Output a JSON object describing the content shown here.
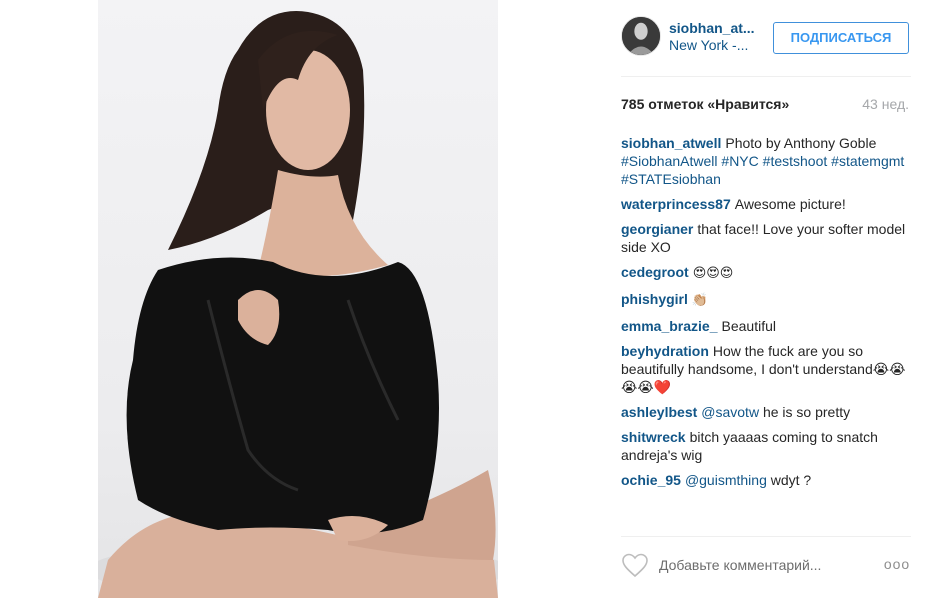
{
  "post": {
    "username": "siobhan_at...",
    "location": "New York -...",
    "follow_label": "ПОДПИСАТЬСЯ",
    "likes": "785 отметок «Нравится»",
    "time_ago": "43 нед."
  },
  "comments": [
    {
      "author": "siobhan_atwell",
      "text": "Photo by Anthony Goble #SiobhanAtwell #NYC #testshoot #statemgmt #STATEsiobhan"
    },
    {
      "author": "waterprincess87",
      "text": "Awesome picture!"
    },
    {
      "author": "georgianer",
      "text": "that face!! Love your softer model side XO"
    },
    {
      "author": "cedegroot",
      "text": "😍😍😍"
    },
    {
      "author": "phishygirl",
      "text": "👏🏼"
    },
    {
      "author": "emma_brazie_",
      "text": "Beautiful"
    },
    {
      "author": "beyhydration",
      "text": "How the fuck are you so beautifully handsome, I don't understand😭😭😭😭❤️"
    },
    {
      "author": "ashleylbest",
      "mention": "@savotw",
      "text": "he is so pretty"
    },
    {
      "author": "shitwreck",
      "text": "bitch yaaaas coming to snatch andreja's wig"
    },
    {
      "author": "ochie_95",
      "mention": "@guismthing",
      "text": "wdyt ?"
    }
  ],
  "footer": {
    "comment_placeholder": "Добавьте комментарий...",
    "more_label": "ooo"
  },
  "icons": {
    "like": "heart-outline-icon",
    "more": "ellipsis-icon"
  },
  "colors": {
    "link": "#125688",
    "button": "#3897f0",
    "muted": "#a5a7aa"
  }
}
